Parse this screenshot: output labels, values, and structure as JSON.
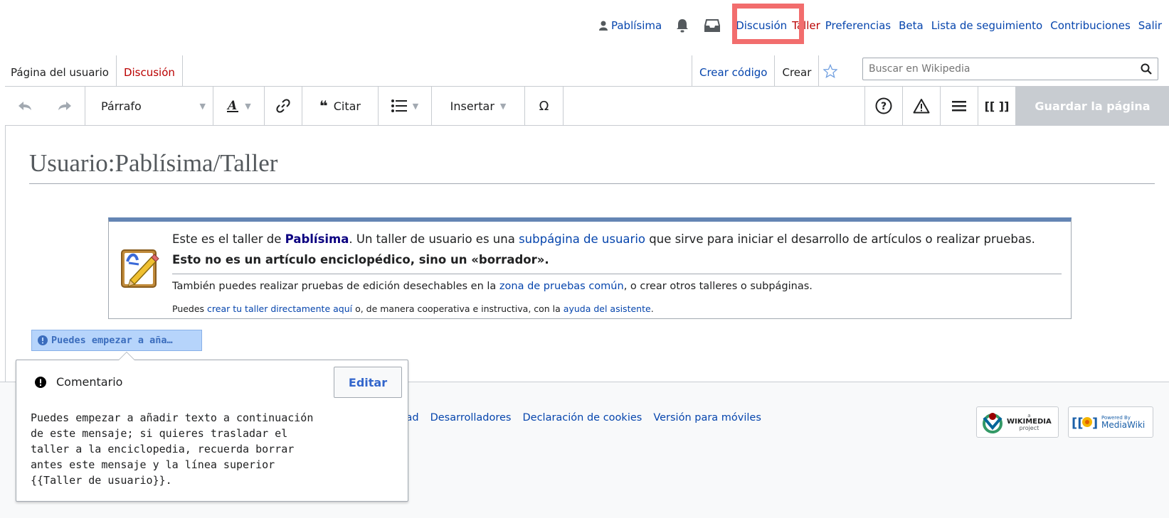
{
  "personal": {
    "username": "Pablísima",
    "links": [
      "Discusión",
      "Taller",
      "Preferencias",
      "Beta",
      "Lista de seguimiento",
      "Contribuciones",
      "Salir"
    ]
  },
  "tabs": {
    "left": [
      "Página del usuario",
      "Discusión"
    ],
    "right": [
      "Crear código",
      "Crear"
    ]
  },
  "search": {
    "placeholder": "Buscar en Wikipedia"
  },
  "toolbar": {
    "paragraph": "Párrafo",
    "cite": "Citar",
    "insert": "Insertar",
    "special_char": "Ω",
    "references": "[[ ]]",
    "save": "Guardar la página"
  },
  "page": {
    "title": "Usuario:Pablísima/Taller"
  },
  "notice": {
    "t1_a": "Este es el taller de ",
    "t1_user": "Pablísima",
    "t1_b": ". Un taller de usuario es una ",
    "t1_link": "subpágina de usuario",
    "t1_c": " que sirve para iniciar el desarrollo de artículos o realizar pruebas. ",
    "t1_bold": "Esto no es un artículo enciclopédico, sino un «borrador».",
    "t2_a": "También puedes realizar pruebas de edición desechables en la ",
    "t2_link": "zona de pruebas común",
    "t2_b": ", o crear otros talleres o subpáginas.",
    "t3_a": "Puedes ",
    "t3_link1": "crear tu taller directamente aquí",
    "t3_b": " o, de manera cooperativa e instructiva, con la ",
    "t3_link2": "ayuda del asistente",
    "t3_c": "."
  },
  "comment_chip": "Puedes empezar a aña…",
  "popup": {
    "title": "Comentario",
    "edit": "Editar",
    "body": "Puedes empezar a añadir texto a continuación\nde este mensaje; si quieres trasladar el\ntaller a la enciclopedia, recuerda borrar\nantes este mensaje y la línea superior\n{{Taller de usuario}}."
  },
  "footer": {
    "links": [
      "bilidad",
      "Desarrolladores",
      "Declaración de cookies",
      "Versión para móviles"
    ],
    "wikimedia_a": "a",
    "wikimedia": "WIKIMEDIA",
    "wikimedia_sub": "project",
    "mediawiki_small": "Powered By",
    "mediawiki": "MediaWiki"
  },
  "colors": {
    "link": "#0645ad",
    "red_link": "#ba0000",
    "save_disabled": "#c8ccd1",
    "highlight": "#f26d6d"
  }
}
